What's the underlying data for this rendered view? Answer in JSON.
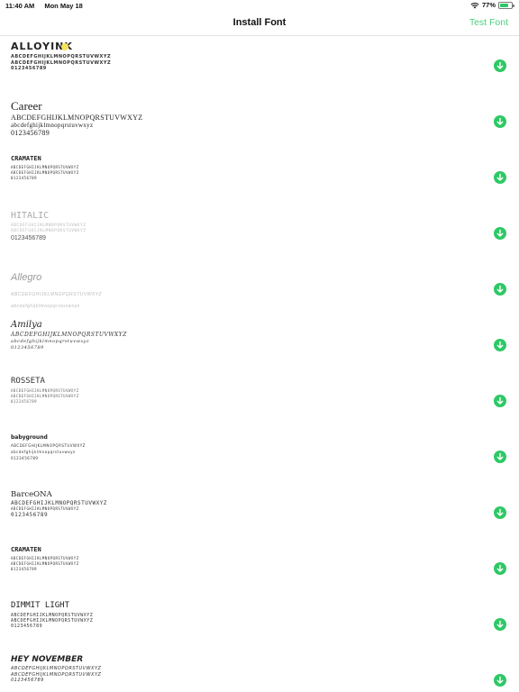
{
  "status_bar": {
    "time": "11:40 AM",
    "date": "Mon May 18",
    "battery_percent": "77%",
    "battery_level": 0.77
  },
  "nav": {
    "title": "Install Font",
    "action": "Test Font"
  },
  "colors": {
    "accent": "#4cd07d",
    "download": "#2ec866"
  },
  "fonts": [
    {
      "name": "ALLOYINK",
      "upper": "ABCDEFGHIJKLMNOPQRSTUVWXYZ",
      "lower": "ABCDEFGHIJKLMNOPQRSTUVWXYZ",
      "digits": "0123456789",
      "icon": "download-icon"
    },
    {
      "name": "Career",
      "upper": "ABCDEFGHIJKLMNOPQRSTUVWXYZ",
      "lower": "abcdefghijklmnopqrstuvwxyz",
      "digits": "0123456789",
      "icon": "download-icon"
    },
    {
      "name": "CRAMATEN",
      "upper": "ABCDEFGHIJKLMNOPQRSTUVWXYZ",
      "lower": "ABCDEFGHIJKLMNOPQRSTUVWXYZ",
      "digits": "0123456789",
      "icon": "download-icon"
    },
    {
      "name": "HITALIC",
      "upper": "ABCDEFGHIJKLMNOPQRSTUVWXYZ",
      "lower": "ABCDEFGHIJKLMNOPQRSTUVWXYZ",
      "digits": "0123456789",
      "icon": "download-icon"
    },
    {
      "name": "Allegro",
      "upper": "ABCDEFGHIJKLMNOPQRSTUVWXYZ",
      "lower": "abcdefghijklmnopqrstuvwxyz",
      "icon": "download-icon"
    },
    {
      "name": "Amilya",
      "upper": "ABCDEFGHIJKLMNOPQRSTUVWXYZ",
      "lower": "abcdefghijklmnopqrstuvwxyz",
      "digits": "0123456789",
      "icon": "download-icon"
    },
    {
      "name": "ROSSETA",
      "upper": "ABCDEFGHIJKLMNOPQRSTUVWXYZ",
      "lower": "ABCDEFGHIJKLMNOPQRSTUVWXYZ",
      "digits": "0123456789",
      "icon": "download-icon"
    },
    {
      "name": "babyground",
      "upper": "ABCDEFGHIJKLMNOPQRSTUVWXYZ",
      "lower": "abcdefghijklmnopqrstuvwxyz",
      "digits": "0123456789",
      "icon": "download-icon"
    },
    {
      "name": "BarceONA",
      "upper": "ABCDEFGHIJKLMNOPQRSTUVWXYZ",
      "lower": "ABCDEFGHIJKLMNOPQRSTUVWXYZ",
      "digits": "0123456789",
      "icon": "download-icon"
    },
    {
      "name": "CRAMATEN",
      "upper": "ABCDEFGHIJKLMNOPQRSTUVWXYZ",
      "lower": "ABCDEFGHIJKLMNOPQRSTUVWXYZ",
      "digits": "0123456789",
      "icon": "download-icon"
    },
    {
      "name": "DIMMIT LIGHT",
      "upper": "ABCDEFGHIJKLMNOPQRSTUVWXYZ",
      "lower": "ABCDEFGHIJKLMNOPQRSTUVWXYZ",
      "digits": "0123456789",
      "icon": "download-icon"
    },
    {
      "name": "HEY NOVEMBER",
      "upper": "ABCDEFGHIJKLMNOPQRSTUVWXYZ",
      "lower": "ABCDEFGHIJKLMNOPQRSTUVWXYZ",
      "digits": "0123456789",
      "icon": "download-icon"
    }
  ]
}
